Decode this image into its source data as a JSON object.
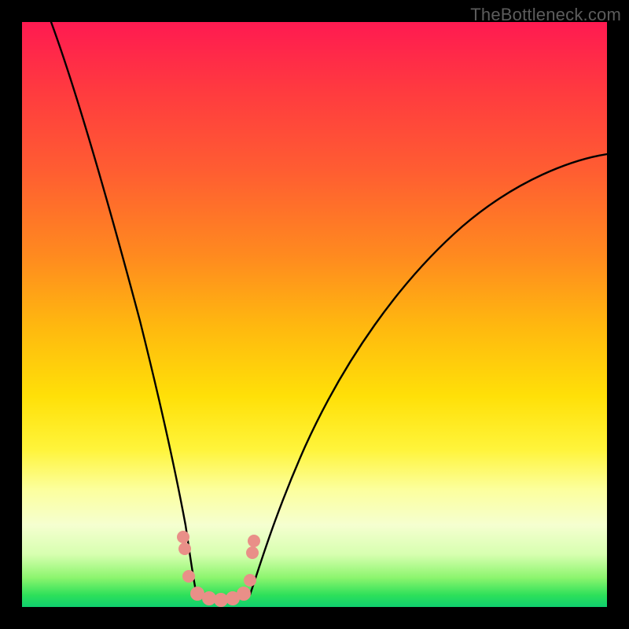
{
  "watermark": "TheBottleneck.com",
  "colors": {
    "frame": "#000000",
    "gradient_top": "#ff1a51",
    "gradient_bottom": "#0fcf6e",
    "curve_stroke": "#000000",
    "marker_fill": "#e98f88"
  },
  "chart_data": {
    "type": "line",
    "title": "",
    "xlabel": "",
    "ylabel": "",
    "xlim": [
      0,
      100
    ],
    "ylim": [
      0,
      100
    ],
    "note": "Axes unlabeled; x is horizontal position 0–100 left→right, y is vertical 0 at bottom → 100 at top. Values estimated from pixel positions.",
    "series": [
      {
        "name": "left-branch",
        "x": [
          5,
          8,
          11,
          14,
          17,
          20,
          22,
          24,
          26,
          27,
          28,
          29
        ],
        "y": [
          100,
          85,
          70,
          56,
          44,
          33,
          25,
          18,
          11,
          7,
          4,
          2
        ]
      },
      {
        "name": "valley-floor",
        "x": [
          29,
          31,
          33,
          35,
          37,
          39
        ],
        "y": [
          2,
          1,
          1,
          1,
          1,
          2
        ]
      },
      {
        "name": "right-branch",
        "x": [
          39,
          41,
          44,
          48,
          53,
          59,
          66,
          74,
          83,
          92,
          100
        ],
        "y": [
          2,
          6,
          12,
          20,
          29,
          39,
          49,
          58,
          66,
          72,
          77
        ]
      }
    ],
    "markers": {
      "name": "salmon-dots",
      "points": [
        {
          "x": 27.5,
          "y": 12
        },
        {
          "x": 27.8,
          "y": 10
        },
        {
          "x": 28.5,
          "y": 5
        },
        {
          "x": 30.0,
          "y": 2.2
        },
        {
          "x": 32.0,
          "y": 1.4
        },
        {
          "x": 34.0,
          "y": 1.2
        },
        {
          "x": 36.0,
          "y": 1.4
        },
        {
          "x": 37.8,
          "y": 2.2
        },
        {
          "x": 39.0,
          "y": 4.5
        },
        {
          "x": 39.3,
          "y": 9
        },
        {
          "x": 39.6,
          "y": 11
        }
      ]
    }
  }
}
